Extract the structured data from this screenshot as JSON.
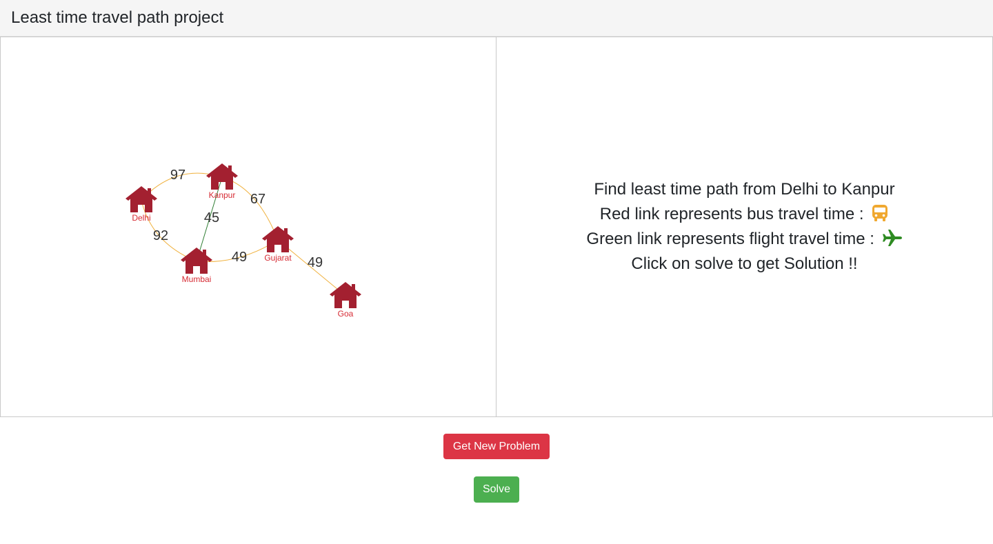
{
  "navbar": {
    "title": "Least time travel path project"
  },
  "graph": {
    "colors": {
      "bus_link": "#f0b240",
      "flight_link": "#2e7d32",
      "node": "#a32030",
      "node_label": "#d62a33"
    },
    "nodes": [
      {
        "id": "delhi",
        "label": "Delhi",
        "icon": "home-icon"
      },
      {
        "id": "kanpur",
        "label": "Kanpur",
        "icon": "home-icon"
      },
      {
        "id": "mumbai",
        "label": "Mumbai",
        "icon": "home-icon"
      },
      {
        "id": "gujarat",
        "label": "Gujarat",
        "icon": "home-icon"
      },
      {
        "id": "goa",
        "label": "Goa",
        "icon": "home-icon"
      }
    ],
    "edges": [
      {
        "from": "delhi",
        "to": "kanpur",
        "weight": "97",
        "type": "bus"
      },
      {
        "from": "kanpur",
        "to": "gujarat",
        "weight": "67",
        "type": "bus"
      },
      {
        "from": "kanpur",
        "to": "mumbai",
        "weight": "45",
        "type": "flight"
      },
      {
        "from": "delhi",
        "to": "mumbai",
        "weight": "92",
        "type": "bus"
      },
      {
        "from": "mumbai",
        "to": "gujarat",
        "weight": "49",
        "type": "bus"
      },
      {
        "from": "gujarat",
        "to": "goa",
        "weight": "49",
        "type": "bus"
      }
    ]
  },
  "info": {
    "line1": "Find least time path from Delhi to Kanpur",
    "line2": "Red link represents bus travel time :",
    "line2_icon": "bus-icon",
    "line3": "Green link represents flight travel time :",
    "line3_icon": "plane-icon",
    "line4": "Click on solve to get Solution !!",
    "bus_icon_color": "#f0a830",
    "plane_icon_color": "#2e8b22"
  },
  "buttons": {
    "new_problem": "Get New Problem",
    "solve": "Solve",
    "new_problem_color": "#dc3545",
    "solve_color": "#4caf50"
  }
}
